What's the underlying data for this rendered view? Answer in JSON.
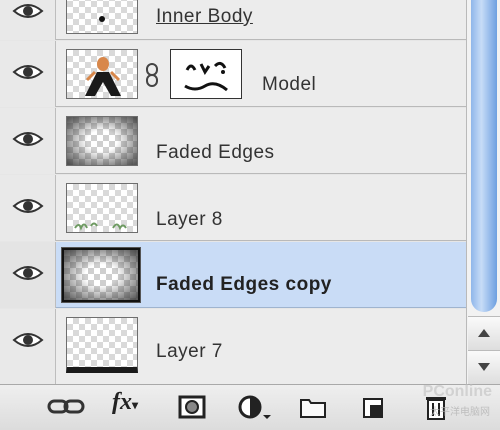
{
  "layers_panel": {
    "layers": [
      {
        "name": "Inner Body"
      },
      {
        "name": "Model"
      },
      {
        "name": "Faded Edges"
      },
      {
        "name": "Layer 8"
      },
      {
        "name": "Faded Edges copy"
      },
      {
        "name": "Layer 7"
      }
    ],
    "selected_layer": "Faded Edges copy"
  },
  "toolbar": {
    "fx_label": "fx",
    "icons": [
      "link-icon",
      "fx-icon",
      "layer-mask-icon",
      "adjustment-layer-icon",
      "group-folder-icon",
      "new-layer-icon",
      "trash-icon"
    ]
  },
  "watermark": {
    "text": "PConline",
    "sub": "太平洋电脑网"
  },
  "colors": {
    "selected_row": "#c9dcf6",
    "row": "#ececec",
    "scroll_track": "#8fb6ea"
  }
}
